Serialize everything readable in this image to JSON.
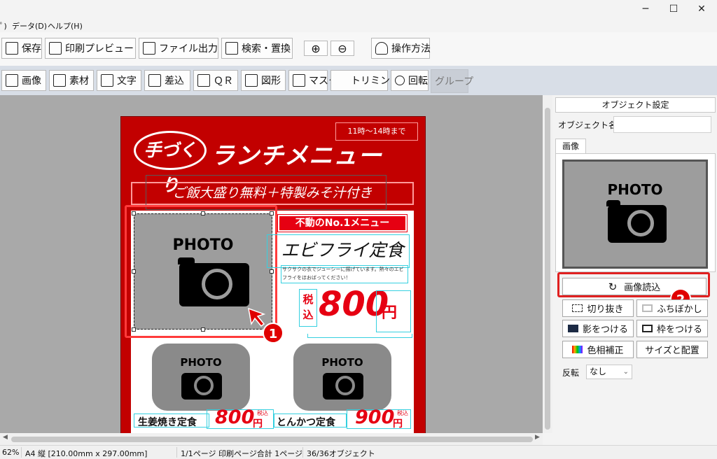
{
  "window": {
    "min": "─",
    "max": "☐",
    "close": "✕"
  },
  "menu": {
    "partial": "ﾟ)",
    "data": "データ(D)",
    "help": "ヘルプ(H)"
  },
  "toolbar1": {
    "save": "保存",
    "print_preview": "印刷プレビュー",
    "file_output": "ファイル出力",
    "search_replace": "検索・置換",
    "zoom_in": "⊕",
    "zoom_out": "⊖",
    "how_to": "操作方法"
  },
  "toolbar2": {
    "image": "画像",
    "material": "素材",
    "text": "文字",
    "insert": "差込",
    "qr": "ＱＲ",
    "shape": "図形",
    "mask": "マスク",
    "trimming": "トリミング",
    "rotate": "回転",
    "group": "グループ"
  },
  "document": {
    "time": "11時～14時まで",
    "logo": "手づくり",
    "title": "ランチメニュー",
    "banner": "ご飯大盛り無料＋特製みそ汁付き",
    "photo_label": "PHOTO",
    "no1": "不動のNo.1メニュー",
    "main_item": "エビフライ定食",
    "description": "サクサクの衣でジューシーに揚げています。熱々のエビフライをほおばってください！",
    "tax_label": "税込",
    "main_price": "800",
    "yen": "円",
    "items": [
      {
        "name": "生姜焼き定食",
        "price": "800",
        "tax": "税込"
      },
      {
        "name": "とんかつ定食",
        "price": "900",
        "tax": "税込"
      }
    ],
    "badge1": "1",
    "badge2": "2"
  },
  "right_panel": {
    "header": "オブジェクト設定",
    "object_name_label": "オブジェクト名",
    "object_name_value": "",
    "tab_image": "画像",
    "photo_label": "PHOTO",
    "load_image": "画像読込",
    "cutout": "切り抜き",
    "blur": "ふちぼかし",
    "shadow": "影をつける",
    "frame": "枠をつける",
    "color_correction": "色相補正",
    "size_position": "サイズと配置",
    "flip_label": "反転",
    "flip_value": "なし"
  },
  "status": {
    "zoom": "62%",
    "paper": "A4 縦 [210.00mm x 297.00mm]",
    "page": "1/1ページ 印刷ページ合計 1ページ",
    "objects": "36/36オブジェクト"
  }
}
